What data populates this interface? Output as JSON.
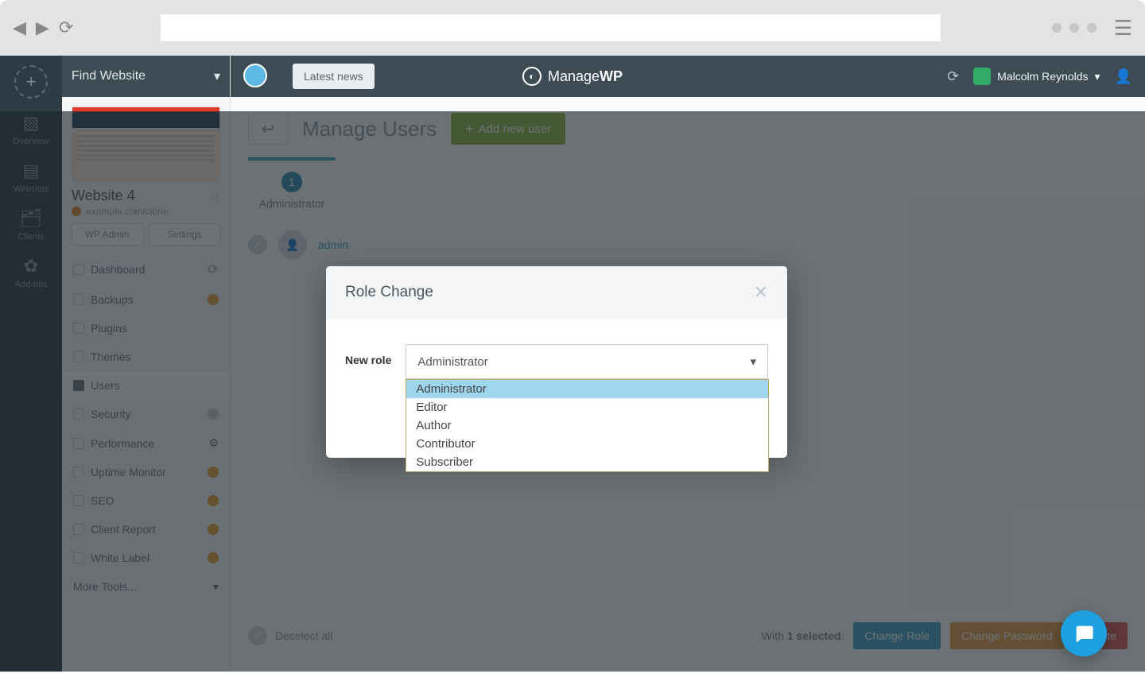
{
  "browser": {
    "url": ""
  },
  "rail": {
    "overview": "Overview",
    "websites": "Websites",
    "clients": "Clients",
    "addons": "Add-ons"
  },
  "siteSelector": "Find Website",
  "site": {
    "name": "Website 4",
    "domain": "example.com/clone",
    "wpAdmin": "WP Admin",
    "settings": "Settings"
  },
  "nav": {
    "dashboard": "Dashboard",
    "backups": "Backups",
    "plugins": "Plugins",
    "themes": "Themes",
    "users": "Users",
    "security": "Security",
    "performance": "Performance",
    "uptime": "Uptime Monitor",
    "seo": "SEO",
    "clientReport": "Client Report",
    "whiteLabel": "White Label",
    "moreTools": "More Tools..."
  },
  "topbar": {
    "news": "Latest news",
    "brand1": "Manage",
    "brand2": "WP",
    "userName": "Malcolm Reynolds"
  },
  "page": {
    "title": "Manage Users",
    "addUser": "Add new user",
    "roleTabLabel": "Administrator",
    "roleTabCount": "1",
    "userName": "admin"
  },
  "footer": {
    "deselect": "Deselect all",
    "withPrefix": "With ",
    "selectedCount": "1 selected",
    "colon": ":",
    "changeRole": "Change Role",
    "changePassword": "Change Password",
    "delete": "Delete"
  },
  "modal": {
    "title": "Role Change",
    "label": "New role",
    "selected": "Administrator",
    "options": {
      "0": "Administrator",
      "1": "Editor",
      "2": "Author",
      "3": "Contributor",
      "4": "Subscriber"
    }
  }
}
